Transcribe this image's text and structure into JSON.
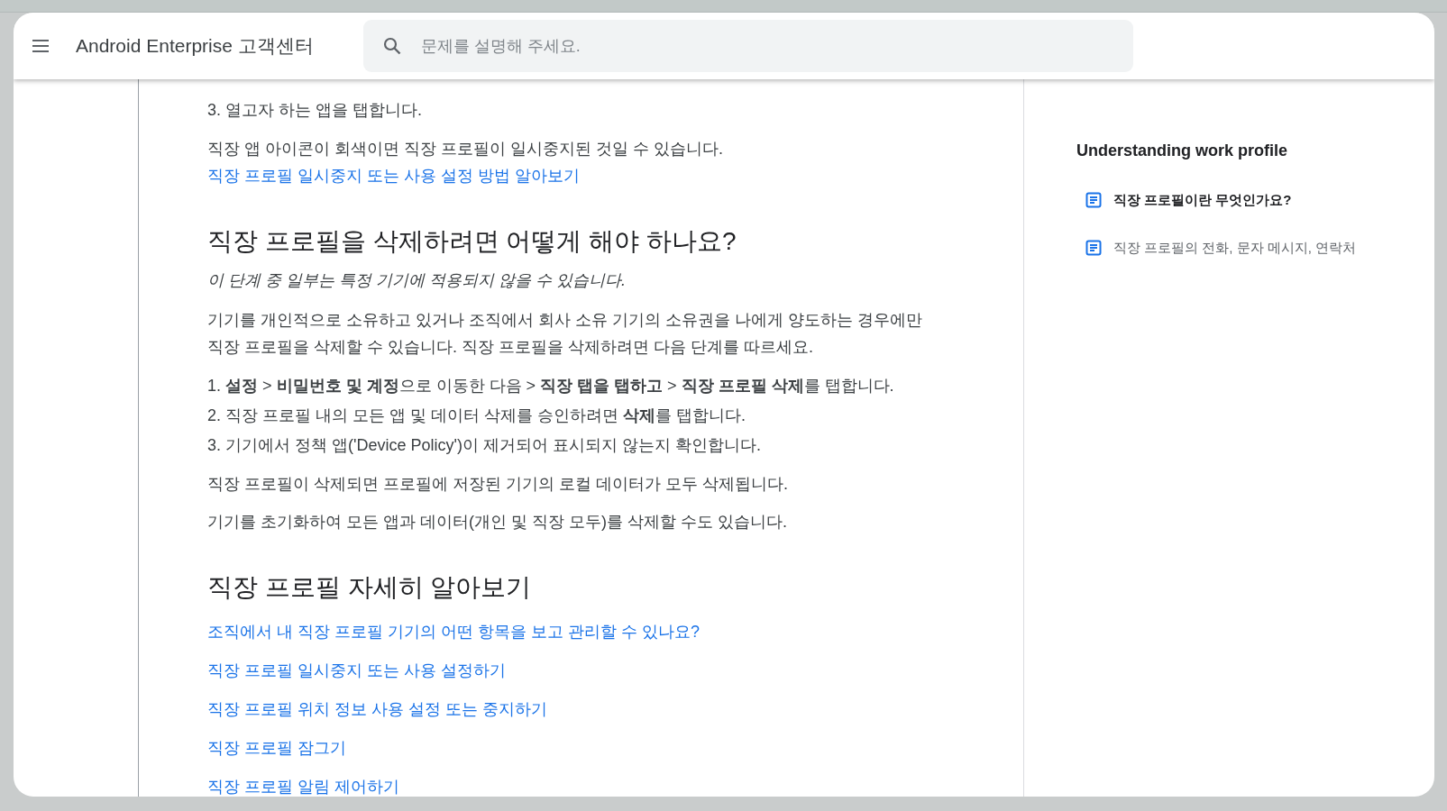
{
  "header": {
    "title": "Android Enterprise 고객센터",
    "search": {
      "placeholder": "문제를 설명해 주세요."
    }
  },
  "article": {
    "blocks": [
      {
        "kind": "step",
        "text": "3. 열고자 하는 앱을 탭합니다."
      },
      {
        "kind": "paragraph",
        "text": "직장 앱 아이콘이 회색이면 직장 프로필이 일시중지된 것일 수 있습니다.",
        "link": "직장 프로필 일시중지 또는 사용 설정 방법 알아보기"
      },
      {
        "kind": "heading",
        "text": "직장 프로필을 삭제하려면 어떻게 해야 하나요?"
      },
      {
        "kind": "note",
        "text": "이 단계 중 일부는 특정 기기에 적용되지 않을 수 있습니다."
      },
      {
        "kind": "paragraph",
        "text": "기기를 개인적으로 소유하고 있거나 조직에서 회사 소유 기기의 소유권을 나에게 양도하는 경우에만 직장 프로필을 삭제할 수 있습니다. 직장 프로필을 삭제하려면 다음 단계를 따르세요."
      },
      {
        "kind": "step",
        "text": "1. **설정** > **비밀번호 및 계정**으로 이동한 다음 > **직장 탭을 탭하고** > **직장 프로필 삭제**를 탭합니다."
      },
      {
        "kind": "step",
        "text": "2. 직장 프로필 내의 모든 앱 및 데이터 삭제를 승인하려면 **삭제**를 탭합니다."
      },
      {
        "kind": "step",
        "text": "3. 기기에서 정책 앱('Device Policy')이 제거되어 표시되지 않는지 확인합니다."
      },
      {
        "kind": "paragraph",
        "text": "직장 프로필이 삭제되면 프로필에 저장된 기기의 로컬 데이터가 모두 삭제됩니다."
      },
      {
        "kind": "paragraph",
        "text": "기기를 초기화하여 모든 앱과 데이터(개인 및 직장 모두)를 삭제할 수도 있습니다."
      },
      {
        "kind": "heading",
        "text": "직장 프로필 자세히 알아보기"
      },
      {
        "kind": "link",
        "text": "조직에서 내 직장 프로필 기기의 어떤 항목을 보고 관리할 수 있나요?"
      },
      {
        "kind": "link",
        "text": "직장 프로필 일시중지 또는 사용 설정하기"
      },
      {
        "kind": "link",
        "text": "직장 프로필 위치 정보 사용 설정 또는 중지하기"
      },
      {
        "kind": "link",
        "text": "직장 프로필 잠그기"
      },
      {
        "kind": "link",
        "text": "직장 프로필 알림 제어하기"
      }
    ]
  },
  "sidebar": {
    "title": "Understanding work profile",
    "items": [
      {
        "label": "직장 프로필이란 무엇인가요?",
        "selected": true
      },
      {
        "label": "직장 프로필의 전화, 문자 메시지, 연락처",
        "selected": false
      }
    ]
  }
}
